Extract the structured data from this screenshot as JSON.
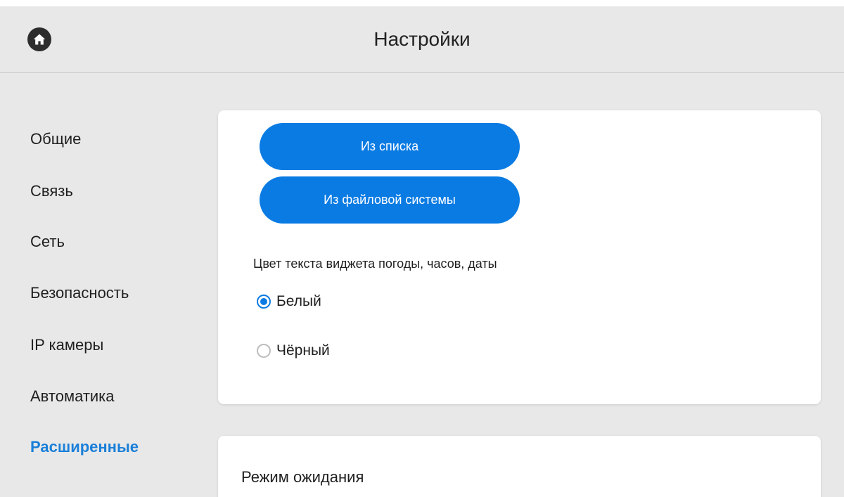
{
  "header": {
    "title": "Настройки",
    "home_icon": "home-icon"
  },
  "sidebar": {
    "items": [
      {
        "label": "Общие",
        "active": false
      },
      {
        "label": "Связь",
        "active": false
      },
      {
        "label": "Сеть",
        "active": false
      },
      {
        "label": "Безопасность",
        "active": false
      },
      {
        "label": "IP камеры",
        "active": false
      },
      {
        "label": "Автоматика",
        "active": false
      },
      {
        "label": "Расширенные",
        "active": true
      }
    ]
  },
  "wallpaper_card": {
    "buttons": [
      {
        "label": "Из списка"
      },
      {
        "label": "Из файловой системы"
      }
    ],
    "widget_color_label": "Цвет текста виджета погоды, часов, даты",
    "options": [
      {
        "label": "Белый",
        "selected": true
      },
      {
        "label": "Чёрный",
        "selected": false
      }
    ]
  },
  "standby_card": {
    "title": "Режим ожидания"
  },
  "colors": {
    "accent": "#0a7be3",
    "active_nav": "#1a7fd9",
    "background": "#e8e8e8",
    "card": "#ffffff"
  }
}
